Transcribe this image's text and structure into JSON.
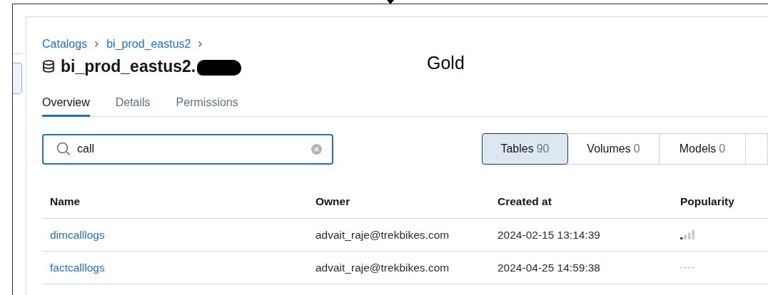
{
  "breadcrumbs": [
    {
      "label": "Catalogs"
    },
    {
      "label": "bi_prod_eastus2"
    }
  ],
  "title": {
    "text": "bi_prod_eastus2.",
    "redacted": true
  },
  "annotation": "Gold",
  "tabs": [
    {
      "label": "Overview",
      "selected": true
    },
    {
      "label": "Details",
      "selected": false
    },
    {
      "label": "Permissions",
      "selected": false
    }
  ],
  "search": {
    "value": "call"
  },
  "type_filters": [
    {
      "label": "Tables",
      "count": "90",
      "selected": true
    },
    {
      "label": "Volumes",
      "count": "0",
      "selected": false
    },
    {
      "label": "Models",
      "count": "0",
      "selected": false
    }
  ],
  "table": {
    "columns": [
      "Name",
      "Owner",
      "Created at",
      "Popularity"
    ],
    "rows": [
      {
        "name": "dimcalllogs",
        "owner": "advait_raje@trekbikes.com",
        "created_at": "2024-02-15 13:14:39",
        "popularity": {
          "kind": "bars",
          "level": 0.25
        }
      },
      {
        "name": "factcalllogs",
        "owner": "advait_raje@trekbikes.com",
        "created_at": "2024-04-25 14:59:38",
        "popularity": {
          "kind": "none"
        }
      }
    ]
  }
}
